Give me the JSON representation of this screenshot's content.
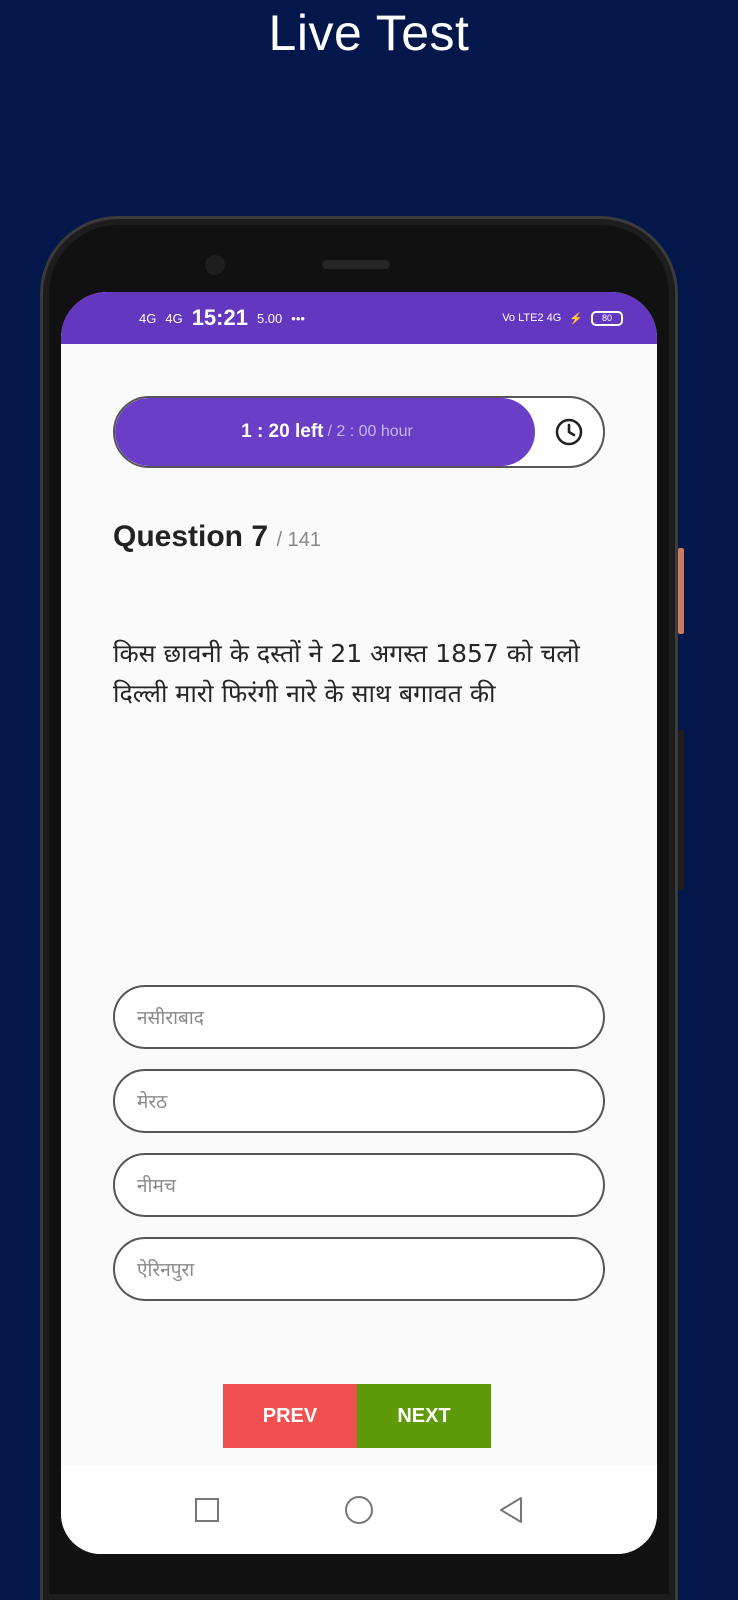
{
  "page": {
    "title": "Live Test"
  },
  "colors": {
    "background": "#03174a",
    "accent": "#6a3ec7",
    "prev": "#f05050",
    "next": "#5e9a0a"
  },
  "status_bar": {
    "signal_1": "4G",
    "signal_2": "4G",
    "time": "15:21",
    "net_speed": "5.00",
    "right_label": "Vo LTE2 4G",
    "battery": "80"
  },
  "timer": {
    "left_label": "1 : 20 left",
    "total_label": "/ 2 : 00 hour",
    "remaining_fraction": 0.86,
    "icon": "clock-icon"
  },
  "question": {
    "label": "Question 7",
    "total": "/ 141",
    "text": "किस छावनी के दस्तों ने 21 अगस्त 1857 को चलो दिल्ली मारो फिरंगी नारे के साथ बगावत की"
  },
  "options": [
    "नसीराबाद",
    "मेरठ",
    "नीमच",
    "ऐरिनपुरा"
  ],
  "buttons": {
    "prev": "PREV",
    "next": "NEXT"
  },
  "system_nav": [
    "square-icon",
    "circle-icon",
    "back-triangle-icon"
  ]
}
